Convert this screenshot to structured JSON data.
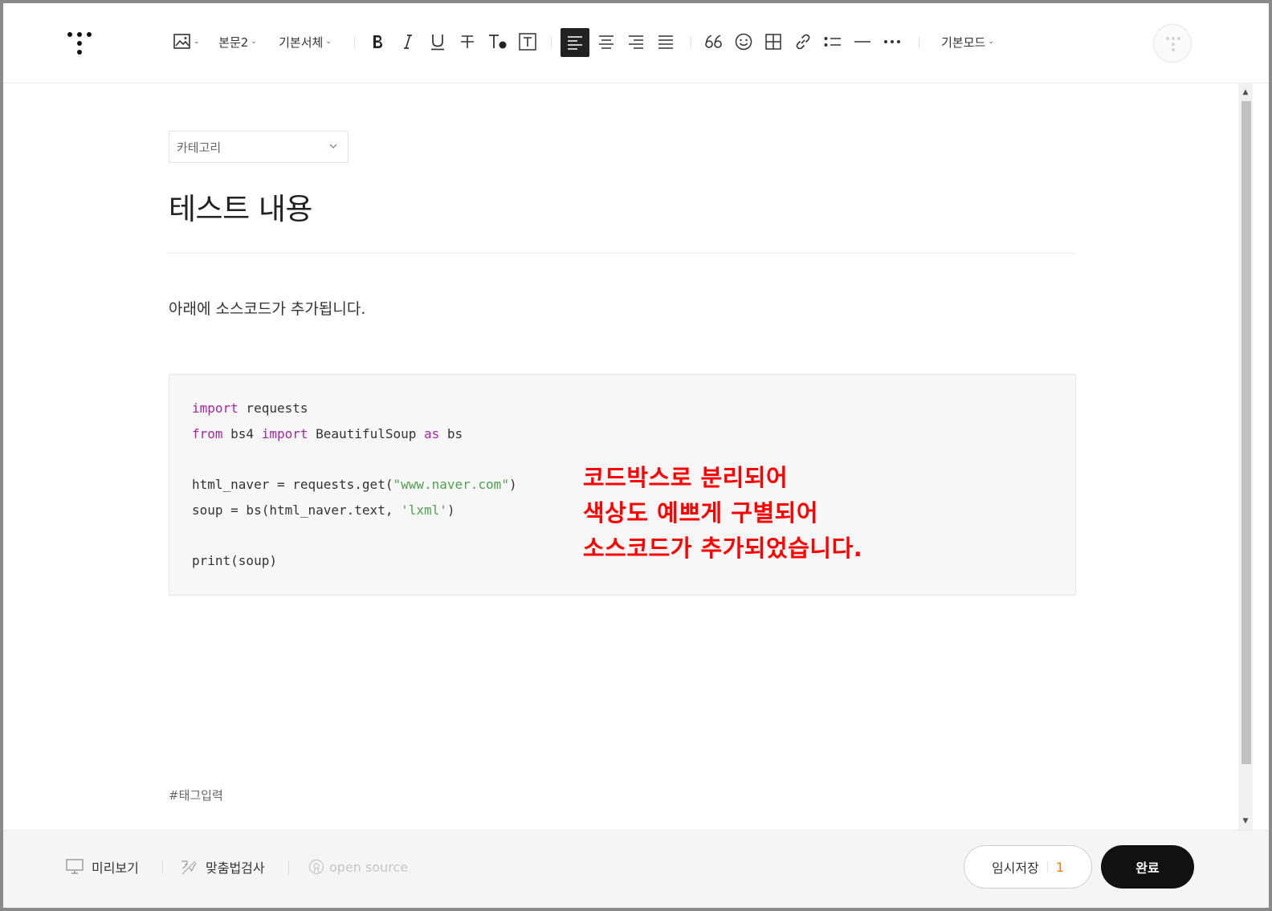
{
  "toolbar": {
    "paragraph_style": "본문2",
    "font_family": "기본서체",
    "mode": "기본모드"
  },
  "editor": {
    "category_placeholder": "카테고리",
    "title": "테스트 내용",
    "paragraph": "아래에 소스코드가 추가됩니다.",
    "code": {
      "line1_kw": "import",
      "line1_rest": " requests",
      "line2_kw1": "from",
      "line2_mid1": " bs4 ",
      "line2_kw2": "import",
      "line2_mid2": " BeautifulSoup ",
      "line2_kw3": "as",
      "line2_rest": " bs",
      "line3_pre": "html_naver = requests.get(",
      "line3_str": "\"www.naver.com\"",
      "line3_post": ")",
      "line4_pre": "soup = bs(html_naver.text, ",
      "line4_str": "'lxml'",
      "line4_post": ")",
      "line5": "print(soup)"
    },
    "annotation": [
      "코드박스로 분리되어",
      "색상도 예쁘게 구별되어",
      "소스코드가 추가되었습니다."
    ],
    "tag_placeholder": "#태그입력"
  },
  "bottombar": {
    "preview_label": "미리보기",
    "spellcheck_label": "맞춤법검사",
    "opensource_label": "open source",
    "save_label": "임시저장",
    "save_count": "1",
    "done_label": "완료"
  },
  "colors": {
    "keyword": "#a626a4",
    "string": "#50a14f",
    "annotation": "#ff0000",
    "done_button": "#111111",
    "save_count": "#f57c00"
  }
}
